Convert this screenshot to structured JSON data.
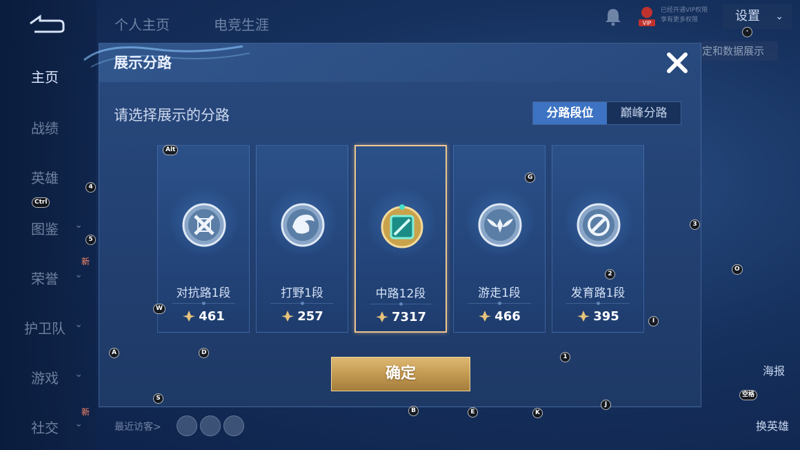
{
  "nav": {
    "items": [
      {
        "label": "主页",
        "active": true
      },
      {
        "label": "战绩"
      },
      {
        "label": "英雄"
      },
      {
        "label": "图鉴"
      },
      {
        "label": "荣誉"
      },
      {
        "label": "护卫队"
      },
      {
        "label": "游戏"
      },
      {
        "label": "社交"
      }
    ],
    "new_badge": "新"
  },
  "top_tabs": [
    "个人主页",
    "电竞生涯"
  ],
  "header": {
    "vip_label": "VIP",
    "vip_text": "已经开通VIP权限 享有更多权限",
    "settings_label": "设置"
  },
  "background_right_tab": "定和数据展示",
  "side_buttons": {
    "poster": "海报",
    "change_hero": "换英雄"
  },
  "visitors_label": "最近访客>",
  "modal": {
    "title": "展示分路",
    "subtitle": "请选择展示的分路",
    "segments": [
      {
        "label": "分路段位",
        "active": true
      },
      {
        "label": "巅峰分路",
        "active": false
      }
    ],
    "cards": [
      {
        "name": "对抗路1段",
        "score": "461",
        "icon": "sword-shield-icon",
        "selected": false
      },
      {
        "name": "打野1段",
        "score": "257",
        "icon": "dragon-icon",
        "selected": false
      },
      {
        "name": "中路12段",
        "score": "7317",
        "icon": "mid-lane-icon",
        "selected": true
      },
      {
        "name": "游走1段",
        "score": "466",
        "icon": "wings-icon",
        "selected": false
      },
      {
        "name": "发育路1段",
        "score": "395",
        "icon": "marksman-icon",
        "selected": false
      }
    ],
    "confirm_label": "确定"
  },
  "key_hints": [
    "Alt",
    "4",
    "Ctrl",
    "5",
    "W",
    "A",
    "D",
    "S",
    "G",
    "3",
    "2",
    "O",
    "I",
    "1",
    "B",
    "E",
    "K",
    "J",
    "空格",
    "·"
  ],
  "colors": {
    "selected_border": "#f0c690",
    "confirm_gold": "#c49a52",
    "segment_active": "#3d73c2"
  }
}
